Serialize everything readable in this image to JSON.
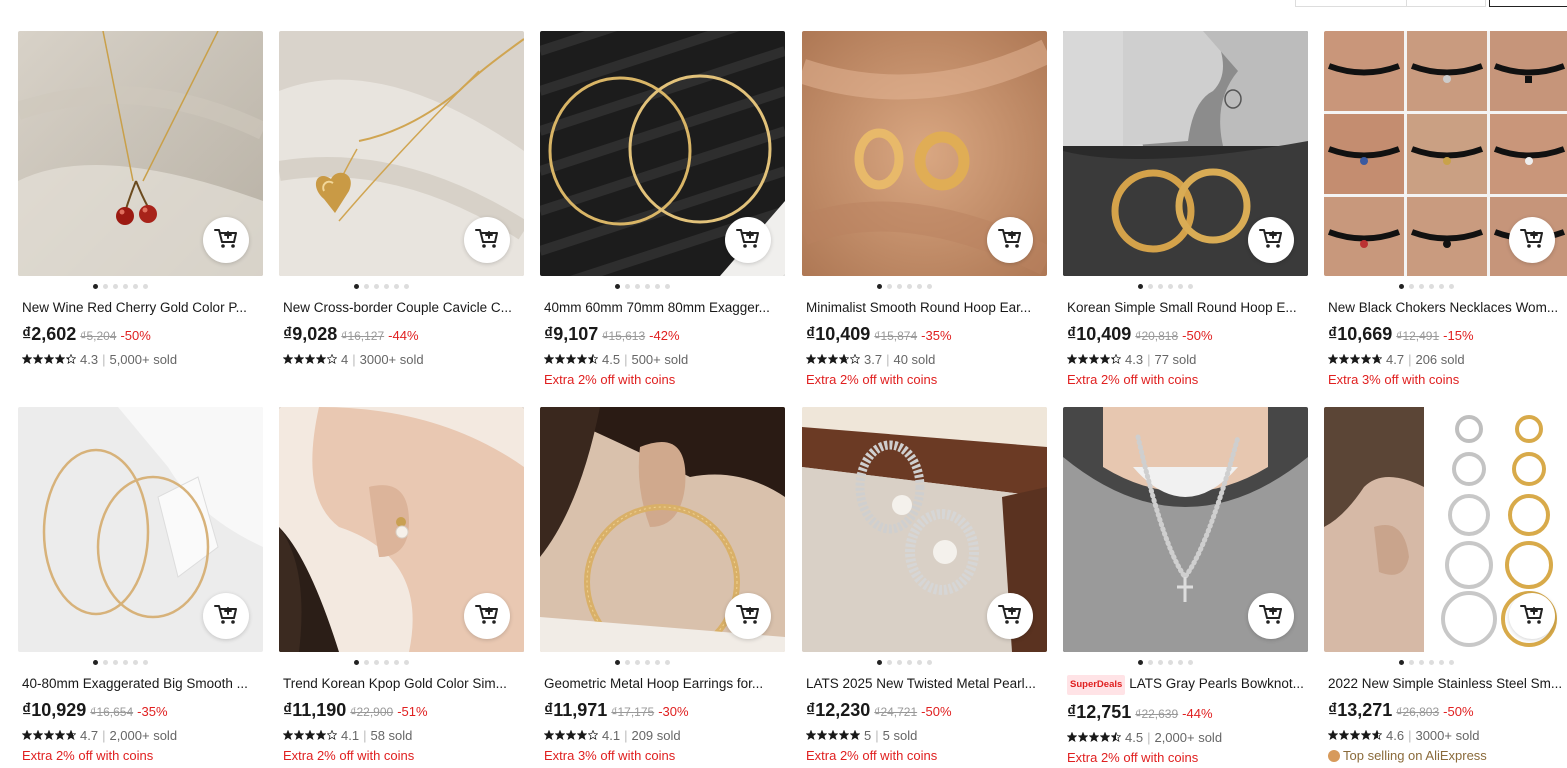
{
  "colors": {
    "accent_red": "#e02020",
    "text": "#191919",
    "muted": "#666666"
  },
  "products": [
    {
      "title": "New Wine Red Cherry Gold Color P...",
      "price": "₫2,602",
      "original": "₫5,204",
      "discount": "-50%",
      "rating": 4.3,
      "rating_text": "4.3",
      "sold": "5,000+ sold",
      "promo": "",
      "badge": "",
      "art": "cherry"
    },
    {
      "title": "New Cross-border Couple Cavicle C...",
      "price": "₫9,028",
      "original": "₫16,127",
      "discount": "-44%",
      "rating": 4.0,
      "rating_text": "4",
      "sold": "3000+ sold",
      "promo": "",
      "badge": "",
      "art": "heart"
    },
    {
      "title": "40mm 60mm 70mm 80mm Exagger...",
      "price": "₫9,107",
      "original": "₫15,613",
      "discount": "-42%",
      "rating": 4.5,
      "rating_text": "4.5",
      "sold": "500+ sold",
      "promo": "Extra 2% off with coins",
      "badge": "",
      "art": "hoops-dark"
    },
    {
      "title": "Minimalist Smooth Round Hoop Ear...",
      "price": "₫10,409",
      "original": "₫15,874",
      "discount": "-35%",
      "rating": 3.7,
      "rating_text": "3.7",
      "sold": "40 sold",
      "promo": "Extra 2% off with coins",
      "badge": "",
      "art": "huggies"
    },
    {
      "title": "Korean Simple Small Round Hoop E...",
      "price": "₫10,409",
      "original": "₫20,818",
      "discount": "-50%",
      "rating": 4.3,
      "rating_text": "4.3",
      "sold": "77 sold",
      "promo": "Extra 2% off with coins",
      "badge": "",
      "art": "korean-hoop"
    },
    {
      "title": "New Black Chokers Necklaces Wom...",
      "price": "₫10,669",
      "original": "₫12,491",
      "discount": "-15%",
      "rating": 4.7,
      "rating_text": "4.7",
      "sold": "206 sold",
      "promo": "Extra 3% off with coins",
      "badge": "",
      "art": "chokers"
    },
    {
      "title": "40-80mm Exaggerated Big Smooth ...",
      "price": "₫10,929",
      "original": "₫16,654",
      "discount": "-35%",
      "rating": 4.7,
      "rating_text": "4.7",
      "sold": "2,000+ sold",
      "promo": "Extra 2% off with coins",
      "badge": "",
      "art": "big-hoops"
    },
    {
      "title": "Trend Korean Kpop Gold Color Sim...",
      "price": "₫11,190",
      "original": "₫22,900",
      "discount": "-51%",
      "rating": 4.1,
      "rating_text": "4.1",
      "sold": "58 sold",
      "promo": "Extra 2% off with coins",
      "badge": "",
      "art": "pearl-ear"
    },
    {
      "title": "Geometric Metal Hoop Earrings for...",
      "price": "₫11,971",
      "original": "₫17,175",
      "discount": "-30%",
      "rating": 4.1,
      "rating_text": "4.1",
      "sold": "209 sold",
      "promo": "Extra 3% off with coins",
      "badge": "",
      "art": "ear-hoop"
    },
    {
      "title": "LATS 2025 New Twisted Metal Pearl...",
      "price": "₫12,230",
      "original": "₫24,721",
      "discount": "-50%",
      "rating": 5.0,
      "rating_text": "5",
      "sold": "5 sold",
      "promo": "Extra 2% off with coins",
      "badge": "",
      "art": "twisted"
    },
    {
      "title": "LATS Gray Pearls Bowknot...",
      "price": "₫12,751",
      "original": "₫22,639",
      "discount": "-44%",
      "rating": 4.5,
      "rating_text": "4.5",
      "sold": "2,000+ sold",
      "promo": "Extra 2% off with coins",
      "badge": "SuperDeals",
      "art": "pearl-chain"
    },
    {
      "title": "2022 New Simple Stainless Steel Sm...",
      "price": "₫13,271",
      "original": "₫26,803",
      "discount": "-50%",
      "rating": 4.6,
      "rating_text": "4.6",
      "sold": "3000+ sold",
      "promo": "Top selling on AliExpress",
      "badge": "",
      "art": "steel-hoops"
    }
  ]
}
